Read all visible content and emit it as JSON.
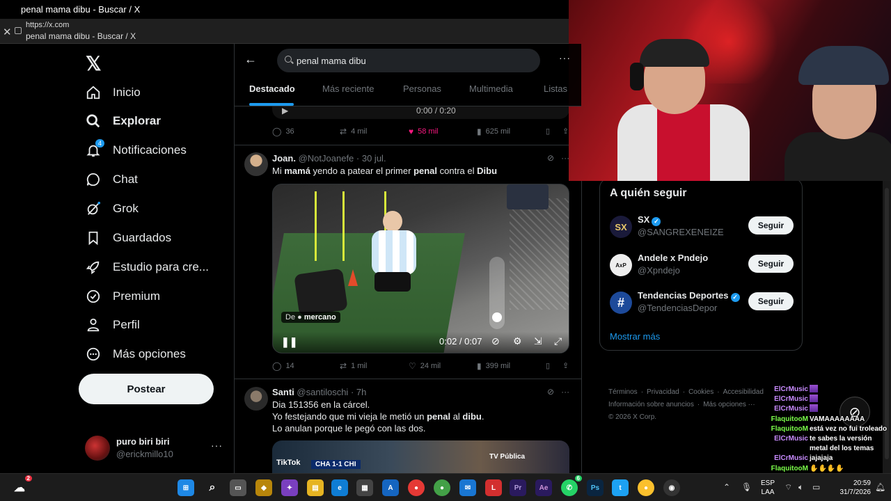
{
  "window_title": "penal mama dibu - Buscar / X",
  "address_bar": {
    "url": "https://x.com",
    "title": "penal mama dibu - Buscar / X"
  },
  "nav": {
    "items": [
      {
        "label": "Inicio",
        "icon": "home-icon"
      },
      {
        "label": "Explorar",
        "icon": "search-icon",
        "active": true
      },
      {
        "label": "Notificaciones",
        "icon": "bell-icon",
        "badge": "4"
      },
      {
        "label": "Chat",
        "icon": "chat-icon"
      },
      {
        "label": "Grok",
        "icon": "grok-icon"
      },
      {
        "label": "Guardados",
        "icon": "bookmark-icon"
      },
      {
        "label": "Estudio para cre...",
        "icon": "rocket-icon"
      },
      {
        "label": "Premium",
        "icon": "verified-icon"
      },
      {
        "label": "Perfil",
        "icon": "person-icon"
      },
      {
        "label": "Más opciones",
        "icon": "more-circle-icon"
      }
    ],
    "post_label": "Postear",
    "account": {
      "name": "puro biri biri",
      "handle": "@erickmillo10"
    }
  },
  "search": {
    "query": "penal mama dibu"
  },
  "tabs": [
    "Destacado",
    "Más reciente",
    "Personas",
    "Multimedia",
    "Listas"
  ],
  "prev_tweet": {
    "video_time": "0:00 / 0:20",
    "actions": {
      "replies": "36",
      "reposts": "4 mil",
      "likes": "58 mil",
      "views": "625 mil"
    }
  },
  "tweet1": {
    "name": "Joan.",
    "handle": "@NotJoanefe",
    "date": "30 jul.",
    "text_parts": [
      "Mi ",
      "mamá",
      " yendo a patear el primer ",
      "penal",
      " contra el ",
      "Dibu"
    ],
    "video": {
      "from_label": "De",
      "from_user": "mercano",
      "time": "0:02 / 0:07"
    },
    "actions": {
      "replies": "14",
      "reposts": "1 mil",
      "likes": "24 mil",
      "views": "399 mil"
    }
  },
  "tweet2": {
    "name": "Santi",
    "handle": "@santiloschi",
    "date": "7h",
    "line1": "Dia 151356 en la cárcel.",
    "line2_parts": [
      "Yo festejando que mi vieja le metió un ",
      "penal",
      " al ",
      "dibu",
      "."
    ],
    "line3": "Lo anulan porque le pegó con las dos.",
    "video": {
      "tiktok": "TikTok",
      "score": "CHA 1-1 CHI",
      "tv": "TV Pública"
    }
  },
  "who_to_follow": {
    "title": "A quién seguir",
    "accounts": [
      {
        "name": "SX",
        "handle": "@SANGREXENEIZE",
        "verified": true,
        "avatar": "SX",
        "color": "#1a1a3a"
      },
      {
        "name": "Andele x Pndejo",
        "handle": "@Xpndejo",
        "verified": false,
        "avatar": "AxP",
        "color": "#eeeeee"
      },
      {
        "name": "Tendencias Deportes",
        "handle": "@TendenciasDepor",
        "verified": true,
        "avatar": "#",
        "color": "#1d4a9a"
      }
    ],
    "follow_label": "Seguir",
    "show_more": "Mostrar más"
  },
  "footer": {
    "line1": [
      "Términos",
      "·",
      "Privacidad",
      "·",
      "Cookies",
      "·",
      "Accesibilidad"
    ],
    "line2": [
      "Información sobre anuncios",
      "·",
      "Más opciones ···"
    ],
    "line3": "© 2026 X Corp."
  },
  "chat_overlay": [
    {
      "user": "ElCrMusic",
      "text": "",
      "emote": true,
      "color": "#c98cff"
    },
    {
      "user": "ElCrMusic",
      "text": "",
      "emote": true,
      "color": "#c98cff"
    },
    {
      "user": "ElCrMusic",
      "text": "",
      "emote": true,
      "color": "#c98cff"
    },
    {
      "user": "FlaquitooM",
      "text": "VAMAAAAAAAA",
      "emote": false,
      "color": "#7cff4a"
    },
    {
      "user": "FlaquitooM",
      "text": "está vez no fui troleado",
      "emote": false,
      "color": "#7cff4a"
    },
    {
      "user": "ElCrMusic",
      "text": "te sabes la versión",
      "emote": false,
      "color": "#c98cff"
    },
    {
      "user": "",
      "text": "metal del los temas",
      "emote": false,
      "color": "#c98cff"
    },
    {
      "user": "ElCrMusic",
      "text": "jajajaja",
      "emote": false,
      "color": "#c98cff"
    },
    {
      "user": "FlaquitooM",
      "text": "",
      "emote": false,
      "color": "#7cff4a"
    }
  ],
  "taskbar": {
    "weather_badge": "2",
    "whatsapp_badge": "6",
    "lang_top": "ESP",
    "lang_bottom": "LAA",
    "time": "20:59",
    "date": "31/7/2026"
  },
  "colors": {
    "accent": "#1d9bf0",
    "like": "#f91880",
    "bg": "#000000"
  }
}
